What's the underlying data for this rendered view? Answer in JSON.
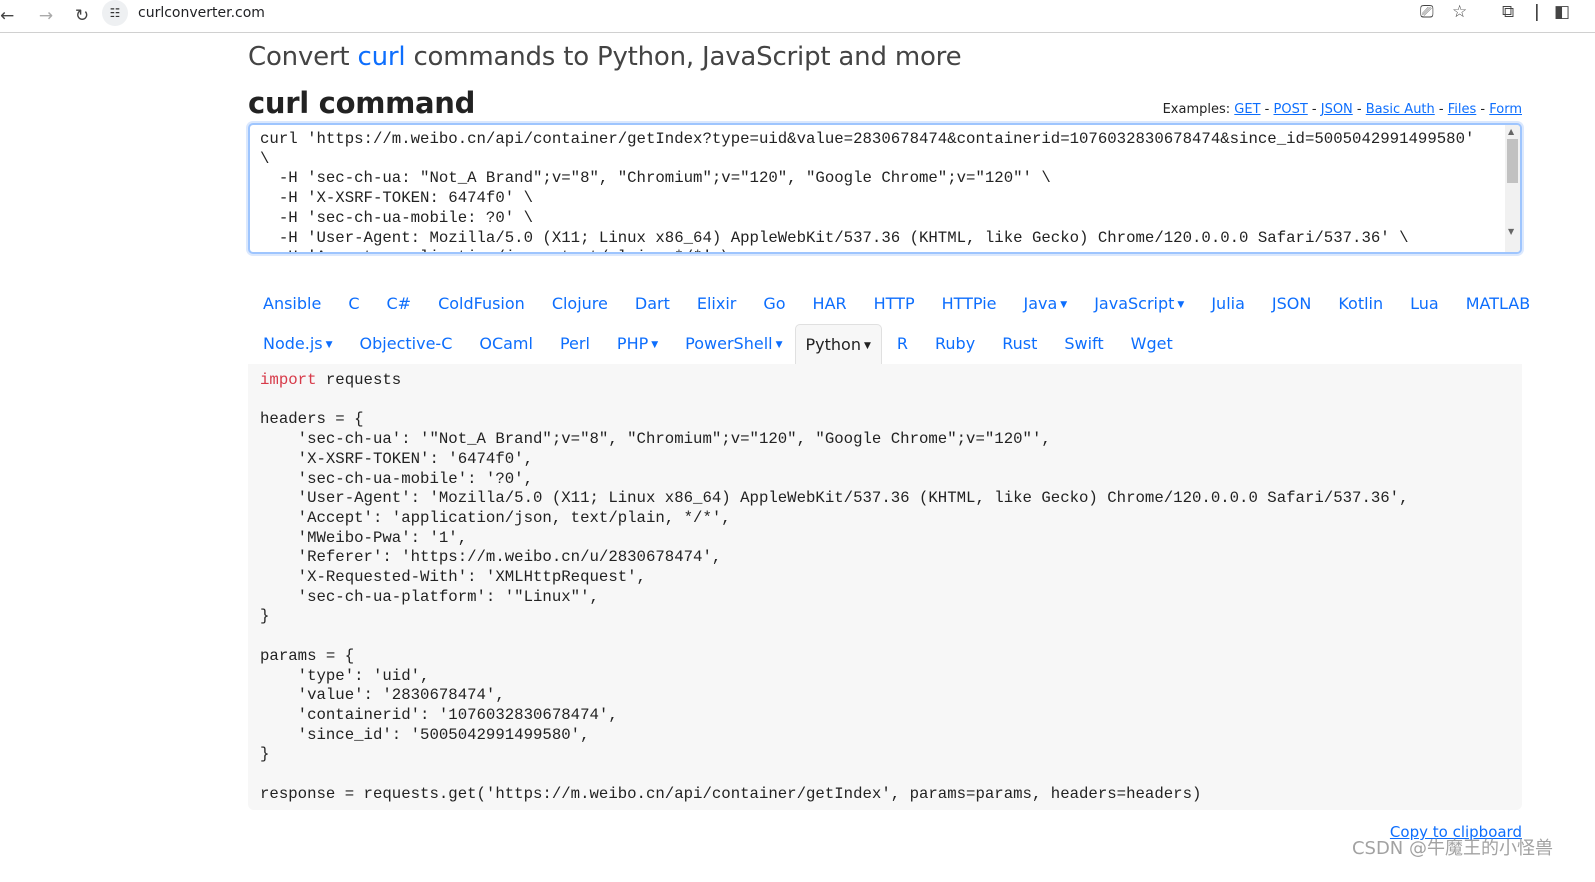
{
  "browser": {
    "url": "curlconverter.com",
    "icons": [
      "back-icon",
      "forward-icon",
      "reload-icon",
      "site-settings-icon",
      "install-icon",
      "star-icon",
      "extensions-icon",
      "sidebar-icon"
    ]
  },
  "header": {
    "title_pre": "Convert ",
    "title_link": "curl",
    "title_post": " commands to Python, JavaScript and more"
  },
  "command": {
    "heading": "curl command",
    "examples_label": "Examples:",
    "examples": [
      "GET",
      "POST",
      "JSON",
      "Basic Auth",
      "Files",
      "Form"
    ],
    "value": "curl 'https://m.weibo.cn/api/container/getIndex?type=uid&value=2830678474&containerid=1076032830678474&since_id=5005042991499580'\n\\\n  -H 'sec-ch-ua: \"Not_A Brand\";v=\"8\", \"Chromium\";v=\"120\", \"Google Chrome\";v=\"120\"' \\\n  -H 'X-XSRF-TOKEN: 6474f0' \\\n  -H 'sec-ch-ua-mobile: ?0' \\\n  -H 'User-Agent: Mozilla/5.0 (X11; Linux x86_64) AppleWebKit/537.36 (KHTML, like Gecko) Chrome/120.0.0.0 Safari/537.36' \\\n  -H 'Accept: application/json, text/plain, */*' \\"
  },
  "languages_row1": [
    {
      "label": "Ansible"
    },
    {
      "label": "C"
    },
    {
      "label": "C#"
    },
    {
      "label": "ColdFusion"
    },
    {
      "label": "Clojure"
    },
    {
      "label": "Dart"
    },
    {
      "label": "Elixir"
    },
    {
      "label": "Go"
    },
    {
      "label": "HAR"
    },
    {
      "label": "HTTP"
    },
    {
      "label": "HTTPie"
    },
    {
      "label": "Java",
      "dropdown": true
    },
    {
      "label": "JavaScript",
      "dropdown": true
    },
    {
      "label": "Julia"
    },
    {
      "label": "JSON"
    },
    {
      "label": "Kotlin"
    },
    {
      "label": "Lua"
    },
    {
      "label": "MATLAB"
    }
  ],
  "languages_row2": [
    {
      "label": "Node.js",
      "dropdown": true
    },
    {
      "label": "Objective-C"
    },
    {
      "label": "OCaml"
    },
    {
      "label": "Perl"
    },
    {
      "label": "PHP",
      "dropdown": true
    },
    {
      "label": "PowerShell",
      "dropdown": true
    },
    {
      "label": "Python",
      "dropdown": true,
      "active": true
    },
    {
      "label": "R"
    },
    {
      "label": "Ruby"
    },
    {
      "label": "Rust"
    },
    {
      "label": "Swift"
    },
    {
      "label": "Wget"
    }
  ],
  "output": {
    "keyword": "import",
    "code_rest": " requests\n\nheaders = {\n    'sec-ch-ua': '\"Not_A Brand\";v=\"8\", \"Chromium\";v=\"120\", \"Google Chrome\";v=\"120\"',\n    'X-XSRF-TOKEN': '6474f0',\n    'sec-ch-ua-mobile': '?0',\n    'User-Agent': 'Mozilla/5.0 (X11; Linux x86_64) AppleWebKit/537.36 (KHTML, like Gecko) Chrome/120.0.0.0 Safari/537.36',\n    'Accept': 'application/json, text/plain, */*',\n    'MWeibo-Pwa': '1',\n    'Referer': 'https://m.weibo.cn/u/2830678474',\n    'X-Requested-With': 'XMLHttpRequest',\n    'sec-ch-ua-platform': '\"Linux\"',\n}\n\nparams = {\n    'type': 'uid',\n    'value': '2830678474',\n    'containerid': '1076032830678474',\n    'since_id': '5005042991499580',\n}\n\nresponse = requests.get('https://m.weibo.cn/api/container/getIndex', params=params, headers=headers)",
    "copy_label": "Copy to clipboard"
  },
  "watermark": "CSDN @牛魔王的小怪兽",
  "colors": {
    "link": "#0d6efd",
    "keyword": "#d73a49",
    "code_bg": "#f7f7f7"
  }
}
